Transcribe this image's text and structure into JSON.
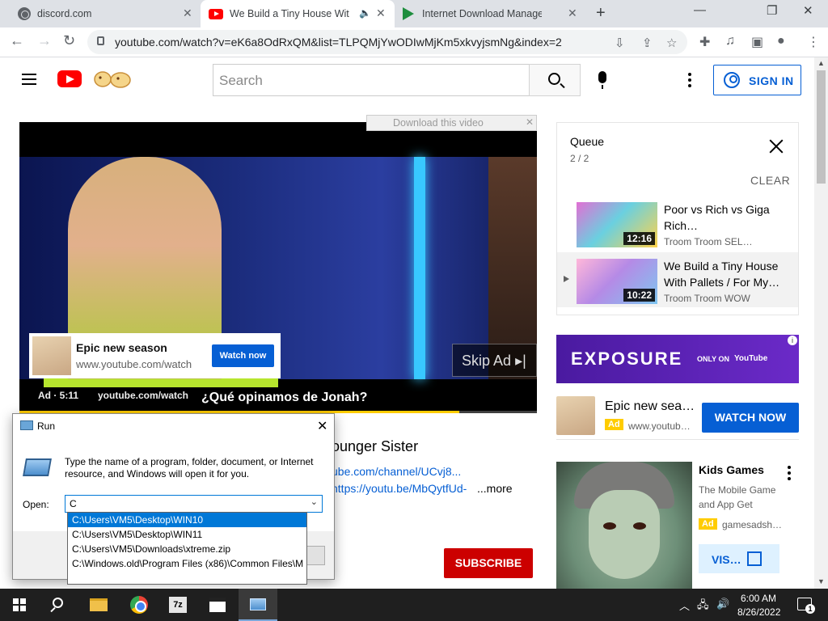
{
  "browser": {
    "tabs": [
      {
        "title": "discord.com",
        "icon": "globe-icon"
      },
      {
        "title": "We Build a Tiny House With",
        "icon": "youtube-icon",
        "active": true
      },
      {
        "title": "Internet Download Manager: I ca",
        "icon": "idm-icon"
      }
    ],
    "new_tab": "+",
    "window_controls": {
      "minimize": "—",
      "restore": "❐",
      "close": "✕"
    },
    "url": "youtube.com/watch?v=eK6a8OdRxQM&list=TLPQMjYwODIwMjKm5xkvyjsmNg&index=2"
  },
  "youtube": {
    "search_placeholder": "Search",
    "sign_in": "SIGN IN",
    "idm_download_label": "Download this video",
    "player": {
      "ad_title": "Epic new season",
      "ad_url": "www.youtube.com/watch",
      "ad_button": "Watch now",
      "skip_label": "Skip Ad",
      "ad_meta": "Ad · 5:11",
      "ad_domain": "youtube.com/watch",
      "caption": "¿Qué opinamos de Jonah?",
      "progress_fraction": 0.85
    },
    "video_title_fragment": "ounger Sister",
    "desc_link1": "ube.com/channel/UCvj8...",
    "desc_link2": "https://youtu.be/MbQytfUd-",
    "more_label": "...more",
    "subscribe_label": "SUBSCRIBE",
    "queue": {
      "title": "Queue",
      "count": "2 / 2",
      "clear": "CLEAR",
      "items": [
        {
          "title": "Poor vs Rich vs Giga Rich…",
          "duration": "12:16",
          "channel": "Troom Troom SEL…",
          "current": false
        },
        {
          "title": "We Build a Tiny House With Pallets / For My…",
          "duration": "10:22",
          "channel": "Troom Troom WOW",
          "current": true
        }
      ]
    },
    "banner": {
      "brand": "EXPOSURE",
      "only_on": "ONLY ON",
      "yt": "YouTube"
    },
    "rail_ad": {
      "title": "Epic new sea…",
      "badge": "Ad",
      "url": "www.youtub…",
      "button": "WATCH NOW"
    },
    "game_ad": {
      "title": "Kids Games",
      "subtitle": "The Mobile Game and App Get",
      "badge": "Ad",
      "url": "gamesadsh…",
      "button": "VIS…"
    }
  },
  "run_dialog": {
    "title": "Run",
    "message": "Type the name of a program, folder, document, or Internet resource, and Windows will open it for you.",
    "open_label": "Open:",
    "open_value": "C",
    "suggestions": [
      "C:\\Users\\VM5\\Desktop\\WIN10",
      "C:\\Users\\VM5\\Desktop\\WIN11",
      "C:\\Users\\VM5\\Downloads\\xtreme.zip",
      "C:\\Windows.old\\Program Files (x86)\\Common Files\\M"
    ]
  },
  "taskbar": {
    "zip_label": "7z",
    "time": "6:00 AM",
    "date": "8/26/2022",
    "notification_count": "1"
  }
}
